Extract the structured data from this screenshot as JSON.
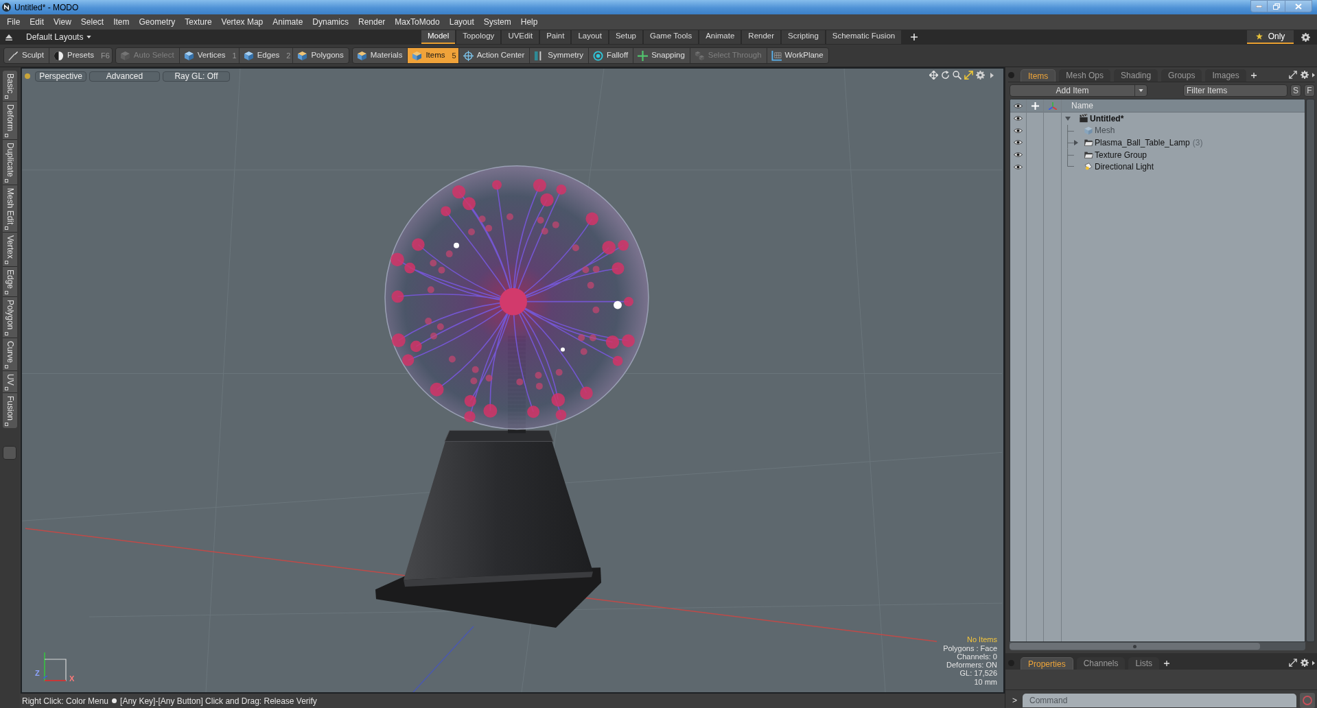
{
  "window": {
    "title": "Untitled* - MODO"
  },
  "menu": [
    "File",
    "Edit",
    "View",
    "Select",
    "Item",
    "Geometry",
    "Texture",
    "Vertex Map",
    "Animate",
    "Dynamics",
    "Render",
    "MaxToModo",
    "Layout",
    "System",
    "Help"
  ],
  "layout_bar": {
    "layouts": "Default Layouts",
    "tabs": [
      {
        "label": "Model",
        "selected": true
      },
      {
        "label": "Topology",
        "selected": false
      },
      {
        "label": "UVEdit",
        "selected": false
      },
      {
        "label": "Paint",
        "selected": false
      },
      {
        "label": "Layout",
        "selected": false
      },
      {
        "label": "Setup",
        "selected": false
      },
      {
        "label": "Game Tools",
        "selected": false
      },
      {
        "label": "Animate",
        "selected": false
      },
      {
        "label": "Render",
        "selected": false
      },
      {
        "label": "Scripting",
        "selected": false
      },
      {
        "label": "Schematic Fusion",
        "selected": false
      }
    ],
    "only": {
      "label": "Only",
      "on": true
    }
  },
  "toolbar": [
    {
      "items": [
        {
          "label": "Sculpt",
          "selected": false,
          "disabled": false
        },
        {
          "label": "Presets",
          "shortcut": "F6",
          "selected": false,
          "disabled": false
        }
      ]
    },
    {
      "items": [
        {
          "label": "Auto Select",
          "selected": false,
          "disabled": true
        },
        {
          "label": "Vertices",
          "shortcut": "1",
          "selected": false,
          "disabled": false
        },
        {
          "label": "Edges",
          "shortcut": "2",
          "selected": false,
          "disabled": false
        },
        {
          "label": "Polygons",
          "selected": false,
          "disabled": false
        }
      ]
    },
    {
      "items": [
        {
          "label": "Materials",
          "selected": false,
          "disabled": false
        },
        {
          "label": "Items",
          "shortcut": "5",
          "selected": true,
          "disabled": false
        },
        {
          "label": "Action Center",
          "selected": false,
          "disabled": false
        },
        {
          "label": "Symmetry",
          "selected": false,
          "disabled": false
        },
        {
          "label": "Falloff",
          "selected": false,
          "disabled": false
        },
        {
          "label": "Snapping",
          "selected": false,
          "disabled": false
        },
        {
          "label": "Select Through",
          "selected": false,
          "disabled": true
        },
        {
          "label": "WorkPlane",
          "selected": false,
          "disabled": false
        }
      ]
    }
  ],
  "side_tabs": [
    "Basic",
    "Deform",
    "Duplicate",
    "Mesh Edit",
    "Vertex",
    "Edge",
    "Polygon",
    "Curve",
    "UV",
    "Fusion"
  ],
  "viewport": {
    "buttons": [
      "Perspective",
      "Advanced",
      "Ray GL: Off"
    ],
    "axis_labels": [
      {
        "text": "Z",
        "color": "#8ea4ff"
      },
      {
        "text": "X",
        "color": "#ff7a7a"
      }
    ],
    "info": [
      {
        "text": "No Items",
        "kind": "alert"
      },
      {
        "text": "Polygons : Face",
        "kind": "plain"
      },
      {
        "text": "Channels: 0",
        "kind": "plain"
      },
      {
        "text": "Deformers: ON",
        "kind": "plain"
      },
      {
        "text": "GL: 17,526",
        "kind": "plain"
      },
      {
        "text": "10 mm",
        "kind": "plain"
      }
    ]
  },
  "items_panel": {
    "tabs": [
      {
        "label": "Items",
        "selected": true
      },
      {
        "label": "Mesh Ops",
        "selected": false
      },
      {
        "label": "Shading",
        "selected": false
      },
      {
        "label": "Groups",
        "selected": false
      },
      {
        "label": "Images",
        "selected": false
      }
    ],
    "add_item": "Add Item",
    "filter": {
      "placeholder": "Filter Items"
    },
    "filter_buttons": [
      "S",
      "F"
    ],
    "columns": [
      "Name"
    ],
    "tree": [
      {
        "name": "Untitled*",
        "kind": "scene",
        "expanded": true,
        "visible": true,
        "dimmed": false,
        "children": [
          {
            "name": "Mesh",
            "kind": "mesh",
            "visible": true,
            "dimmed": true
          },
          {
            "name": "Plasma_Ball_Table_Lamp",
            "count": "(3)",
            "kind": "group",
            "expanded": false,
            "visible": true,
            "dimmed": false
          },
          {
            "name": "Texture Group",
            "kind": "group",
            "visible": true,
            "dimmed": false
          },
          {
            "name": "Directional Light",
            "kind": "light",
            "visible": true,
            "dimmed": false
          }
        ]
      }
    ]
  },
  "properties_panel": {
    "tabs": [
      {
        "label": "Properties",
        "selected": true
      },
      {
        "label": "Channels",
        "selected": false
      },
      {
        "label": "Lists",
        "selected": false
      }
    ]
  },
  "command": {
    "prompt": ">",
    "placeholder": "Command"
  },
  "status_bar": {
    "hint": "Right Click: Color Menu",
    "action": "[Any Key]-[Any Button] Click and Drag: Release Verify"
  }
}
